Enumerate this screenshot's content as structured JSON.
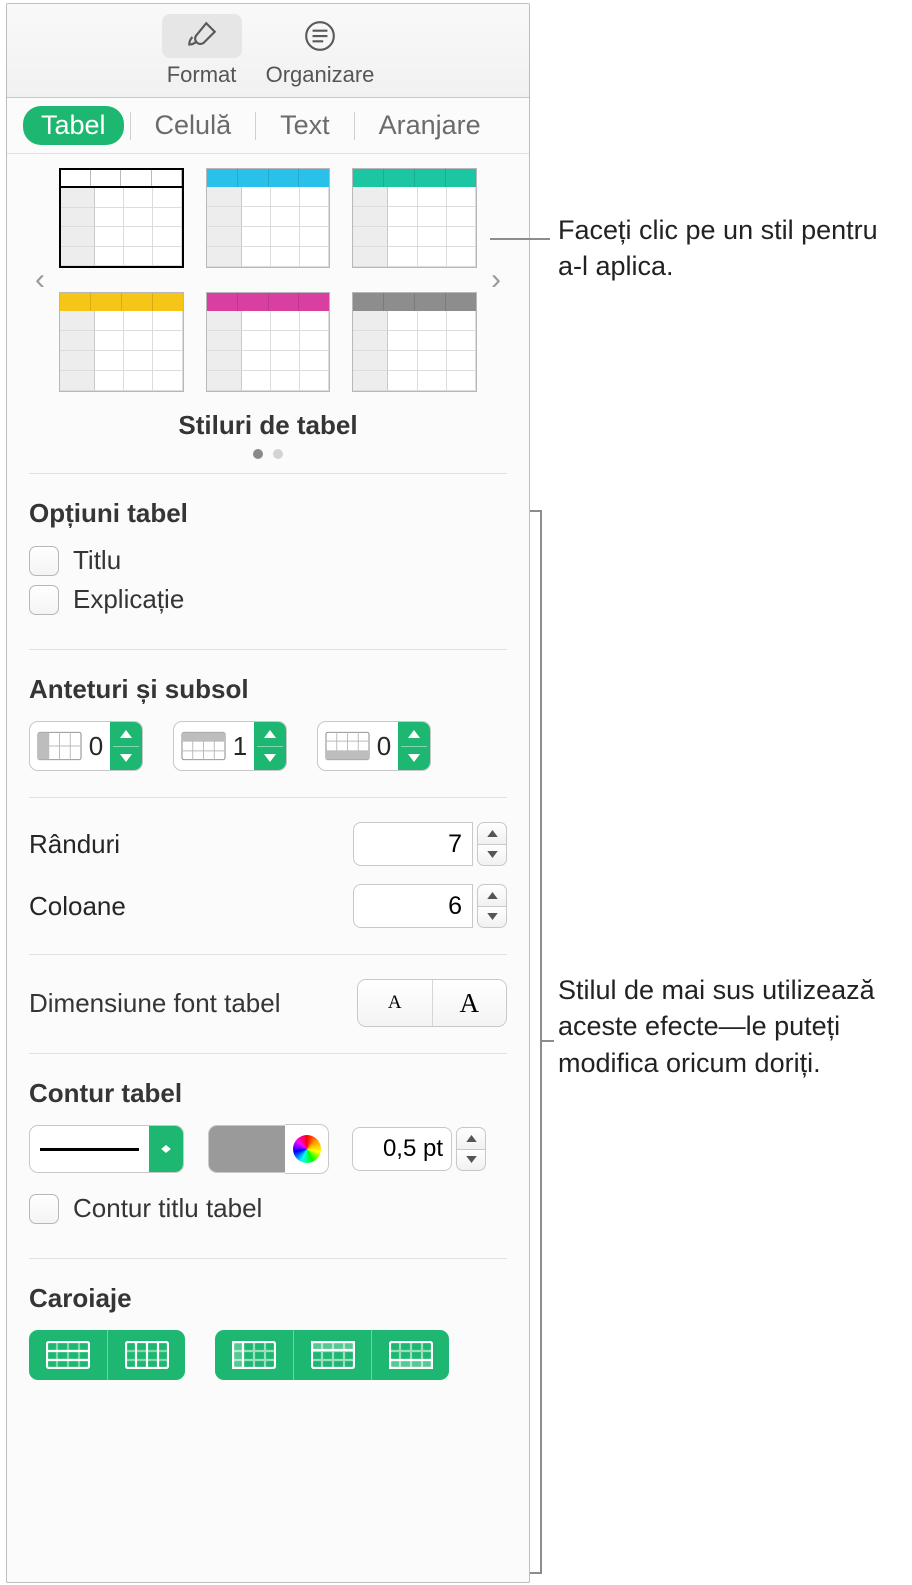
{
  "toolbar": {
    "format_label": "Format",
    "organize_label": "Organizare"
  },
  "subtabs": {
    "table": "Tabel",
    "cell": "Celulă",
    "text": "Text",
    "arrange": "Aranjare"
  },
  "styles": {
    "caption": "Stiluri de tabel",
    "colors": [
      "#ffffff",
      "#29c1ea",
      "#1cc6a3",
      "#f5c518",
      "#d83fa1",
      "#8d8d8d"
    ]
  },
  "table_options": {
    "heading": "Opțiuni tabel",
    "title_label": "Titlu",
    "caption_label": "Explicație",
    "title_checked": false,
    "caption_checked": false
  },
  "headers_footer": {
    "heading": "Anteturi și subsol",
    "header_columns": 0,
    "header_rows": 1,
    "footer_rows": 0
  },
  "rows_cols": {
    "rows_label": "Rânduri",
    "rows_value": 7,
    "cols_label": "Coloane",
    "cols_value": 6
  },
  "font_size": {
    "label": "Dimensiune font tabel"
  },
  "outline": {
    "heading": "Contur tabel",
    "color": "#9a9a9a",
    "width": "0,5 pt",
    "outline_title_label": "Contur titlu tabel",
    "outline_title_checked": false
  },
  "gridlines": {
    "heading": "Caroiaje"
  },
  "annotations": {
    "style_click": "Faceți clic pe un stil pentru a-l aplica.",
    "effects_note": "Stilul de mai sus utilizează aceste efecte—le puteți modifica oricum doriți."
  }
}
